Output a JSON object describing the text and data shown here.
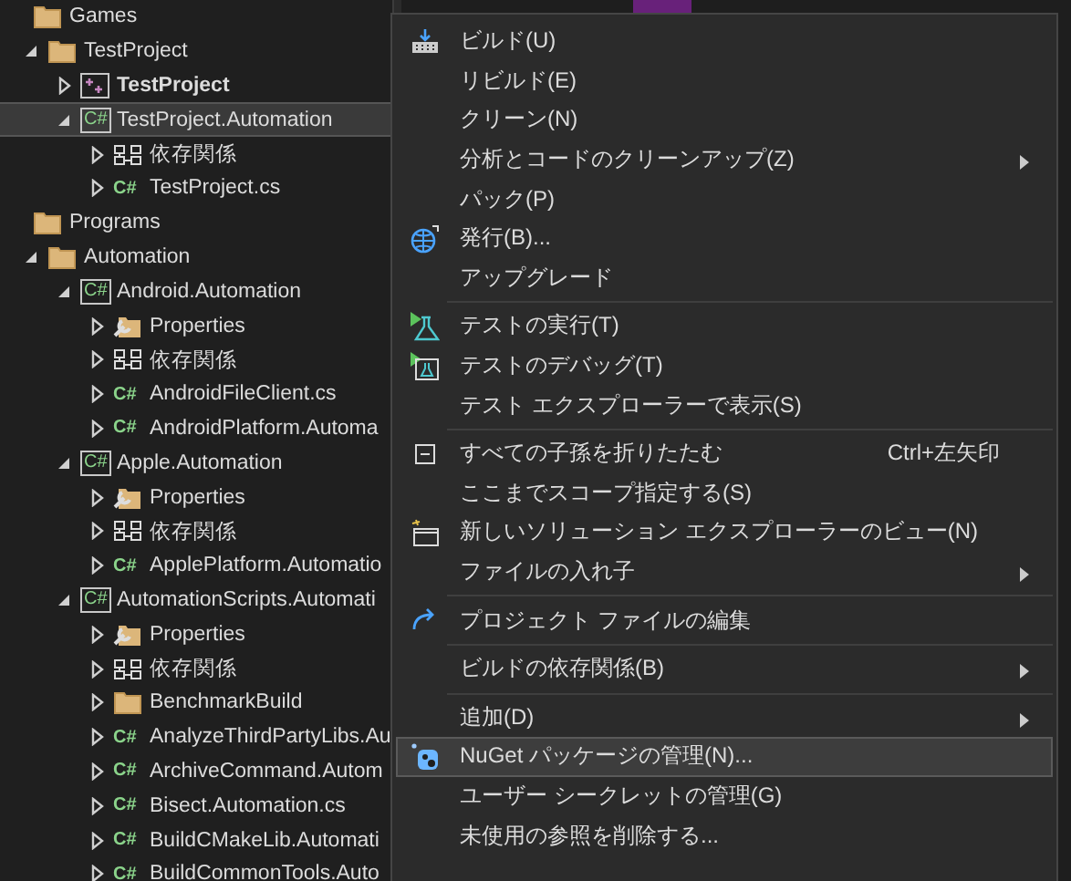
{
  "tree": [
    {
      "label": "Games",
      "kind": "folder",
      "selected": false,
      "children": [
        {
          "label": "TestProject",
          "kind": "folder",
          "expanded": true,
          "selected": false,
          "children": [
            {
              "label": "TestProject",
              "kind": "cpp-project",
              "expanded": false,
              "selected": false,
              "bold": true
            },
            {
              "label": "TestProject.Automation",
              "kind": "cs-project",
              "icon_text": "C#",
              "expanded": true,
              "selected": true,
              "children": [
                {
                  "label": "依存関係",
                  "kind": "dependencies",
                  "expanded": false,
                  "selected": false
                },
                {
                  "label": "TestProject.cs",
                  "kind": "cs-file",
                  "icon_text": "C#",
                  "expanded": false,
                  "selected": false
                }
              ]
            }
          ]
        }
      ]
    },
    {
      "label": "Programs",
      "kind": "folder",
      "selected": false,
      "children": [
        {
          "label": "Automation",
          "kind": "folder",
          "expanded": true,
          "selected": false,
          "children": [
            {
              "label": "Android.Automation",
              "kind": "cs-project",
              "icon_text": "C#",
              "expanded": true,
              "selected": false,
              "children": [
                {
                  "label": "Properties",
                  "kind": "properties",
                  "expanded": false,
                  "selected": false
                },
                {
                  "label": "依存関係",
                  "kind": "dependencies",
                  "expanded": false,
                  "selected": false
                },
                {
                  "label": "AndroidFileClient.cs",
                  "kind": "cs-file",
                  "icon_text": "C#",
                  "expanded": false,
                  "selected": false
                },
                {
                  "label": "AndroidPlatform.Automa",
                  "kind": "cs-file",
                  "icon_text": "C#",
                  "expanded": false,
                  "selected": false
                }
              ]
            },
            {
              "label": "Apple.Automation",
              "kind": "cs-project",
              "icon_text": "C#",
              "expanded": true,
              "selected": false,
              "children": [
                {
                  "label": "Properties",
                  "kind": "properties",
                  "expanded": false,
                  "selected": false
                },
                {
                  "label": "依存関係",
                  "kind": "dependencies",
                  "expanded": false,
                  "selected": false
                },
                {
                  "label": "ApplePlatform.Automatio",
                  "kind": "cs-file",
                  "icon_text": "C#",
                  "expanded": false,
                  "selected": false
                }
              ]
            },
            {
              "label": "AutomationScripts.Automati",
              "kind": "cs-project",
              "icon_text": "C#",
              "expanded": true,
              "selected": false,
              "children": [
                {
                  "label": "Properties",
                  "kind": "properties",
                  "expanded": false,
                  "selected": false
                },
                {
                  "label": "依存関係",
                  "kind": "dependencies",
                  "expanded": false,
                  "selected": false
                },
                {
                  "label": "BenchmarkBuild",
                  "kind": "folder",
                  "expanded": false,
                  "selected": false
                },
                {
                  "label": "AnalyzeThirdPartyLibs.Au",
                  "kind": "cs-file",
                  "icon_text": "C#",
                  "expanded": false,
                  "selected": false
                },
                {
                  "label": "ArchiveCommand.Autom",
                  "kind": "cs-file",
                  "icon_text": "C#",
                  "expanded": false,
                  "selected": false
                },
                {
                  "label": "Bisect.Automation.cs",
                  "kind": "cs-file",
                  "icon_text": "C#",
                  "expanded": false,
                  "selected": false
                },
                {
                  "label": "BuildCMakeLib.Automati",
                  "kind": "cs-file",
                  "icon_text": "C#",
                  "expanded": false,
                  "selected": false
                },
                {
                  "label": "BuildCommonTools.Auto",
                  "kind": "cs-file",
                  "icon_text": "C#",
                  "expanded": false,
                  "selected": false
                }
              ]
            }
          ]
        }
      ]
    }
  ],
  "menu": [
    {
      "kind": "item",
      "label": "ビルド(U)",
      "submenu": false,
      "highlighted": false
    },
    {
      "kind": "item",
      "label": "リビルド(E)",
      "submenu": false,
      "highlighted": false
    },
    {
      "kind": "item",
      "label": "クリーン(N)",
      "submenu": false,
      "highlighted": false
    },
    {
      "kind": "item",
      "label": "分析とコードのクリーンアップ(Z)",
      "submenu": true,
      "highlighted": false
    },
    {
      "kind": "item",
      "label": "パック(P)",
      "submenu": false,
      "highlighted": false
    },
    {
      "kind": "item",
      "label": "発行(B)...",
      "submenu": false,
      "highlighted": false
    },
    {
      "kind": "item",
      "label": "アップグレード",
      "submenu": false,
      "highlighted": false
    },
    {
      "kind": "separator"
    },
    {
      "kind": "item",
      "label": "テストの実行(T)",
      "submenu": false,
      "highlighted": false
    },
    {
      "kind": "item",
      "label": "テストのデバッグ(T)",
      "submenu": false,
      "highlighted": false
    },
    {
      "kind": "item",
      "label": "テスト エクスプローラーで表示(S)",
      "submenu": false,
      "highlighted": false
    },
    {
      "kind": "separator"
    },
    {
      "kind": "item",
      "label": "すべての子孫を折りたたむ",
      "shortcut": "Ctrl+左矢印",
      "submenu": false,
      "highlighted": false
    },
    {
      "kind": "item",
      "label": "ここまでスコープ指定する(S)",
      "submenu": false,
      "highlighted": false
    },
    {
      "kind": "item",
      "label": "新しいソリューション エクスプローラーのビュー(N)",
      "submenu": false,
      "highlighted": false
    },
    {
      "kind": "item",
      "label": "ファイルの入れ子",
      "submenu": true,
      "highlighted": false
    },
    {
      "kind": "separator"
    },
    {
      "kind": "item",
      "label": "プロジェクト ファイルの編集",
      "submenu": false,
      "highlighted": false
    },
    {
      "kind": "separator"
    },
    {
      "kind": "item",
      "label": "ビルドの依存関係(B)",
      "submenu": true,
      "highlighted": false
    },
    {
      "kind": "separator"
    },
    {
      "kind": "item",
      "label": "追加(D)",
      "submenu": true,
      "highlighted": false
    },
    {
      "kind": "item",
      "label": "NuGet パッケージの管理(N)...",
      "submenu": false,
      "highlighted": true
    },
    {
      "kind": "item",
      "label": "ユーザー シークレットの管理(G)",
      "submenu": false,
      "highlighted": false
    },
    {
      "kind": "item",
      "label": "未使用の参照を削除する...",
      "submenu": false,
      "highlighted": false
    }
  ]
}
